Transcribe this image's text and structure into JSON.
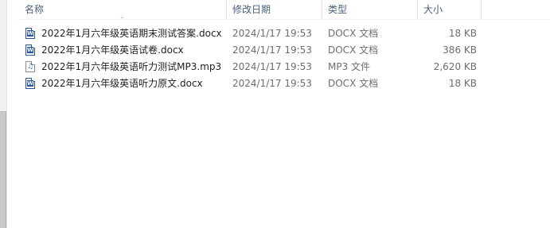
{
  "columns": {
    "name": "名称",
    "modified": "修改日期",
    "type": "类型",
    "size": "大小"
  },
  "files": [
    {
      "name": "2022年1月六年级英语期末测试答案.docx",
      "modified": "2024/1/17 19:53",
      "type": "DOCX 文档",
      "size": "18 KB",
      "icon": "word-document-icon"
    },
    {
      "name": "2022年1月六年级英语试卷.docx",
      "modified": "2024/1/17 19:53",
      "type": "DOCX 文档",
      "size": "386 KB",
      "icon": "word-document-icon"
    },
    {
      "name": "2022年1月六年级英语听力测试MP3.mp3",
      "modified": "2024/1/17 19:53",
      "type": "MP3 文件",
      "size": "2,620 KB",
      "icon": "audio-file-icon"
    },
    {
      "name": "2022年1月六年级英语听力原文.docx",
      "modified": "2024/1/17 19:53",
      "type": "DOCX 文档",
      "size": "18 KB",
      "icon": "word-document-icon"
    }
  ],
  "colors": {
    "header_text": "#4c607a",
    "meta_text": "#6d6d6d",
    "word_blue": "#2b5797"
  }
}
